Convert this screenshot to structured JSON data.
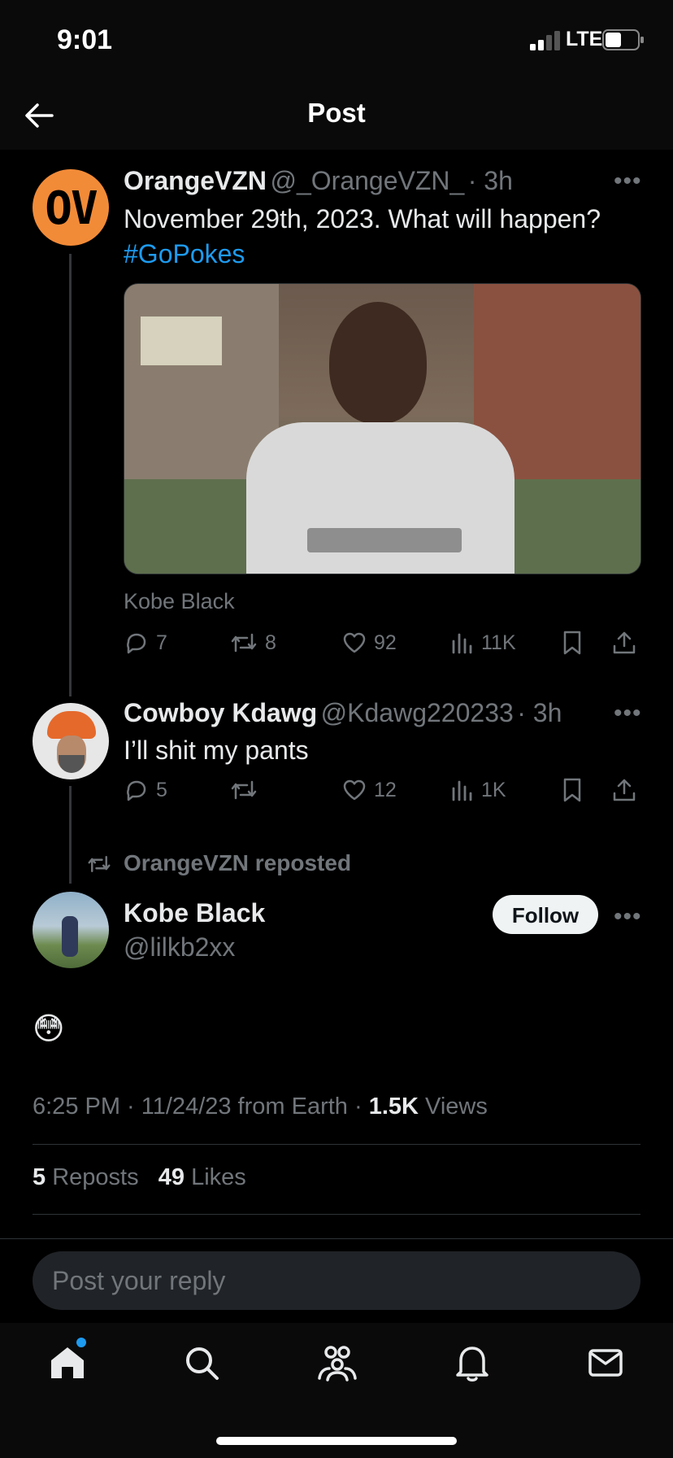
{
  "status_bar": {
    "time": "9:01",
    "network": "LTE"
  },
  "header": {
    "title": "Post"
  },
  "tweets": [
    {
      "avatar_text": "OV",
      "name": "OrangeVZN",
      "handle": "@_OrangeVZN_",
      "time": "· 3h",
      "text": "November 29th, 2023. What will happen?",
      "hashtag": "#GoPokes",
      "image_caption": "Kobe Black",
      "replies": "7",
      "reposts": "8",
      "likes": "92",
      "views": "11K"
    },
    {
      "name": "Cowboy Kdawg",
      "handle": "@Kdawg220233",
      "time": "· 3h",
      "text": "I’ll shit my pants",
      "replies": "5",
      "reposts": "",
      "likes": "12",
      "views": "1K"
    }
  ],
  "repost_label": "OrangeVZN reposted",
  "main_post": {
    "name": "Kobe Black",
    "handle": "@lilkb2xx",
    "follow_label": "Follow",
    "emoji": "😳",
    "meta_time": "6:25 PM · 11/24/23 from Earth · ",
    "meta_views_count": "1.5K",
    "meta_views_label": " Views",
    "reposts_count": "5",
    "reposts_label": "Reposts",
    "likes_count": "49",
    "likes_label": "Likes"
  },
  "reply": {
    "placeholder": "Post your reply"
  },
  "colors": {
    "accent": "#1d9bf0",
    "background": "#000000",
    "muted": "#71767b",
    "orange": "#f28b38"
  },
  "icons": [
    "back-arrow-icon",
    "more-icon",
    "reply-icon",
    "repost-icon",
    "like-icon",
    "views-icon",
    "bookmark-icon",
    "share-icon",
    "home-icon",
    "search-icon",
    "communities-icon",
    "notifications-icon",
    "messages-icon"
  ]
}
